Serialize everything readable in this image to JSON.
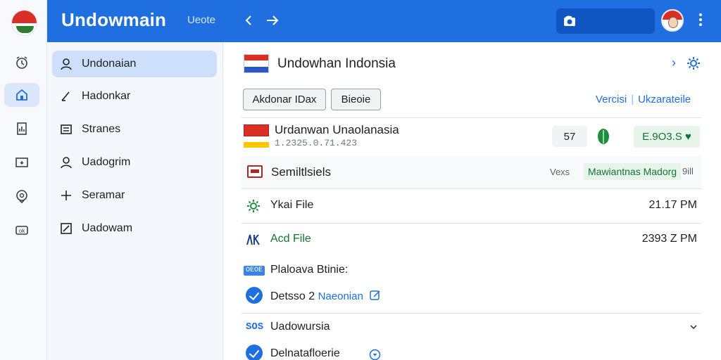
{
  "header": {
    "title": "Undowmain",
    "subtitle": "Ueote",
    "back_icon": "arrow-left-icon",
    "forward_icon": "arrow-right-icon",
    "search_icon": "search-icon",
    "camera_icon": "camera-icon",
    "accent": "#1f6fe0"
  },
  "rail": {
    "items": [
      {
        "icon": "timer-icon"
      },
      {
        "icon": "home-icon",
        "active": true
      },
      {
        "icon": "report-icon"
      },
      {
        "icon": "download-icon"
      },
      {
        "icon": "pin-icon"
      },
      {
        "icon": "ok-icon"
      }
    ]
  },
  "sidebar": {
    "items": [
      {
        "label": "Undonaian",
        "icon": "person-icon",
        "active": true
      },
      {
        "label": "Hadonkar",
        "icon": "edit-icon"
      },
      {
        "label": "Stranes",
        "icon": "list-icon"
      },
      {
        "label": "Uadogrim",
        "icon": "person-icon"
      },
      {
        "label": "Seramar",
        "icon": "plus-icon"
      },
      {
        "label": "Uadowam",
        "icon": "edit-box-icon"
      }
    ]
  },
  "main": {
    "title": "Undowhan Indonsia",
    "buttons": {
      "primary": "Akdonar IDax",
      "secondary": "Bieoie"
    },
    "links": {
      "first": "Vercisi",
      "second": "Ukzarateile"
    },
    "entity": {
      "title": "Urdanwan Unaolanasia",
      "subtitle": "1.2325.0.71.423",
      "count": "57",
      "amount": "E.9O3.S ♥"
    },
    "section": {
      "label": "Semiltlsiels",
      "meta": "Vexs",
      "badge": "Mawiantnas Madorg",
      "tail": "9ill"
    },
    "files": [
      {
        "label": "Ykai File",
        "time": "21.17 PM",
        "icon": "gear-icon",
        "color": "#202124"
      },
      {
        "label": "Acd File",
        "time": "2393 Z PM",
        "icon": "chart-icon",
        "color": "#137333"
      }
    ],
    "paragraph": {
      "tag": "OEOE",
      "label": "Plaloava Btinie:"
    },
    "task1": {
      "label": "Detsso 2",
      "link": "Naeonian"
    },
    "sos": {
      "tag": "SOS",
      "label": "Uadowursia"
    },
    "task2": {
      "label": "Delnatafloerie"
    }
  }
}
